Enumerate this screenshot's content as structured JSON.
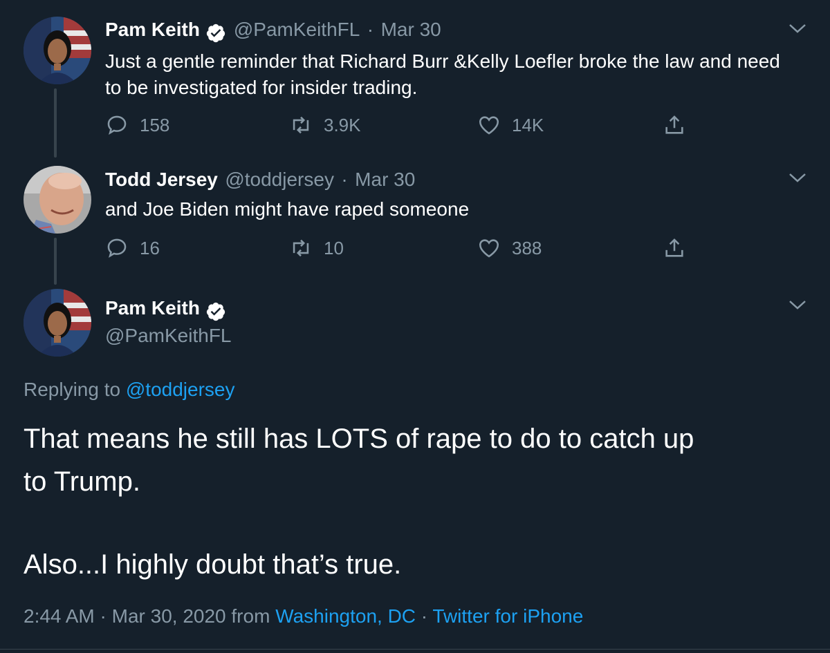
{
  "colors": {
    "background": "#15202b",
    "text": "#ffffff",
    "muted": "#8899a6",
    "link": "#1da1f2",
    "verified": "#ffffff"
  },
  "tweet1": {
    "name": "Pam Keith",
    "handle": "@PamKeithFL",
    "sep": "·",
    "date": "Mar 30",
    "text_line1": "Just a gentle reminder that Richard Burr &Kelly Loefler broke the law and need",
    "text_line2": "to be investigated for insider trading.",
    "replies": "158",
    "retweets": "3.9K",
    "likes": "14K"
  },
  "tweet2": {
    "name": "Todd Jersey",
    "handle": "@toddjersey",
    "sep": "·",
    "date": "Mar 30",
    "text": "and Joe Biden might have raped someone",
    "replies": "16",
    "retweets": "10",
    "likes": "388"
  },
  "main": {
    "name": "Pam Keith",
    "handle": "@PamKeithFL",
    "replying_prefix": "Replying to",
    "replying_to": "@toddjersey",
    "text_line1": "That means he still has LOTS of rape to do to catch up",
    "text_line2": "to Trump.",
    "text_line3": "Also...I highly doubt that’s true.",
    "time": "2:44 AM",
    "date": "Mar 30, 2020",
    "from_label": "from",
    "location": "Washington, DC",
    "source": "Twitter for iPhone",
    "sep": "·"
  },
  "icons": [
    "reply-icon",
    "retweet-icon",
    "like-icon",
    "share-icon",
    "chevron-down-icon",
    "verified-badge-icon"
  ]
}
